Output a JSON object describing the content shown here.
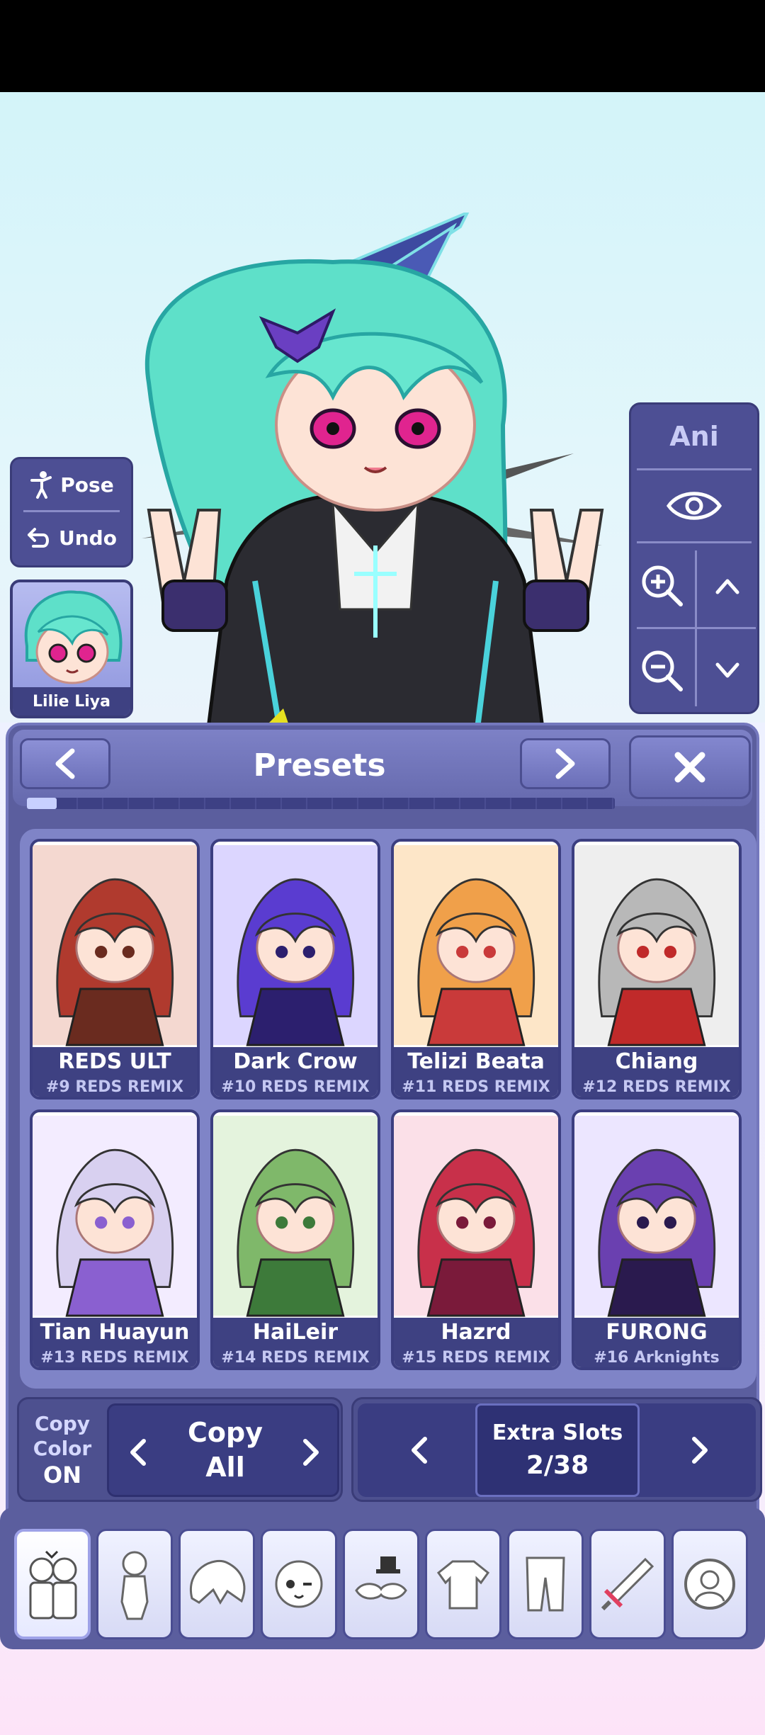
{
  "scene": {
    "pose_label": "Pose",
    "undo_label": "Undo",
    "character_name": "Lilie Liya",
    "ani_label": "Ani"
  },
  "presets": {
    "title": "Presets",
    "page_progress": 0.05,
    "items": [
      {
        "name": "REDS ULT",
        "sub": "#9 REDS REMIX"
      },
      {
        "name": "Dark Crow",
        "sub": "#10 REDS REMIX"
      },
      {
        "name": "Telizi Beata",
        "sub": "#11 REDS REMIX"
      },
      {
        "name": "Chiang",
        "sub": "#12 REDS REMIX"
      },
      {
        "name": "Tian Huayun",
        "sub": "#13 REDS REMIX"
      },
      {
        "name": "HaiLeir",
        "sub": "#14 REDS REMIX"
      },
      {
        "name": "Hazrd",
        "sub": "#15 REDS REMIX"
      },
      {
        "name": "FURONG",
        "sub": "#16 Arknights"
      }
    ]
  },
  "copy": {
    "color_line1": "Copy",
    "color_line2": "Color",
    "color_state": "ON",
    "all_line1": "Copy",
    "all_line2": "All"
  },
  "slots": {
    "label": "Extra Slots",
    "value": "2/38"
  },
  "categories": [
    "presets-icon",
    "body-icon",
    "hair-icon",
    "face-icon",
    "accessory-icon",
    "top-icon",
    "bottom-icon",
    "weapon-icon",
    "profile-icon"
  ],
  "colors": {
    "panel": "#5b5e9e",
    "card_label": "#3e4182",
    "scene_bg": "#d3f4f9"
  }
}
